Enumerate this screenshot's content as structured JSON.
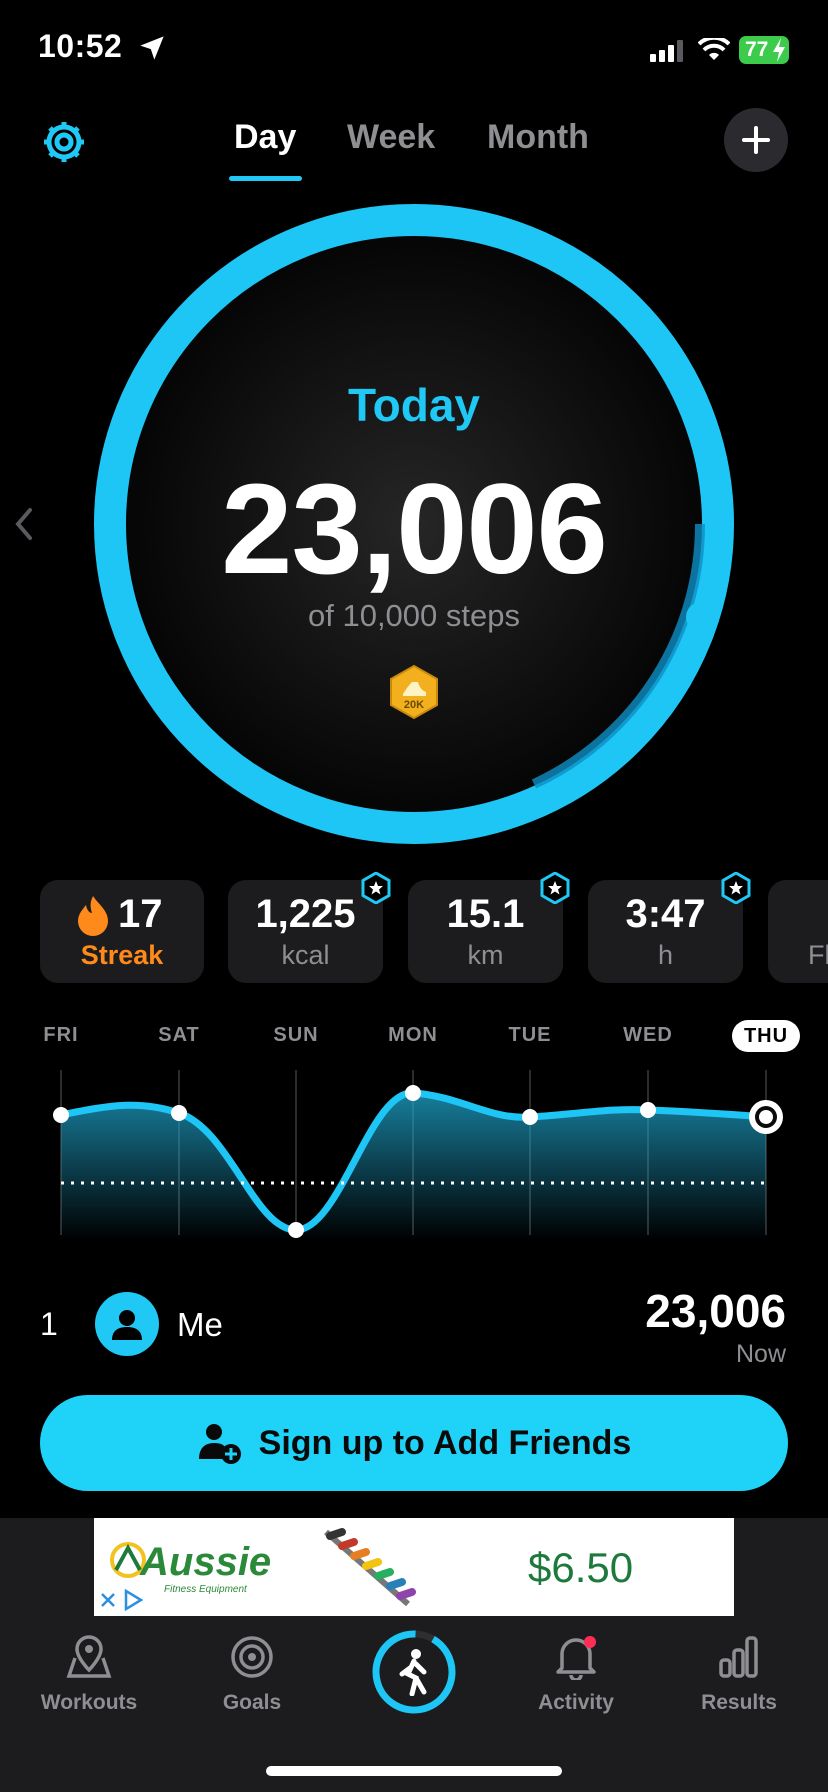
{
  "status_bar": {
    "time": "10:52",
    "battery": "77"
  },
  "header": {
    "tabs": [
      {
        "label": "Day",
        "active": true
      },
      {
        "label": "Week",
        "active": false
      },
      {
        "label": "Month",
        "active": false
      }
    ]
  },
  "ring": {
    "title": "Today",
    "steps": "23,006",
    "goal_text": "of 10,000 steps",
    "badge": "20K",
    "progress_fraction": 2.3
  },
  "stats": {
    "streak": {
      "value": "17",
      "label": "Streak"
    },
    "kcal": {
      "value": "1,225",
      "label": "kcal"
    },
    "km": {
      "value": "15.1",
      "label": "km"
    },
    "hours": {
      "value": "3:47",
      "label": "h"
    },
    "partial_label": "Fl"
  },
  "week_chart": {
    "days": [
      "FRI",
      "SAT",
      "SUN",
      "MON",
      "TUE",
      "WED",
      "THU"
    ],
    "current_day": "THU"
  },
  "leaderboard": {
    "rank": "1",
    "name": "Me",
    "steps": "23,006",
    "time": "Now"
  },
  "signup_button": "Sign up to Add Friends",
  "ad": {
    "brand": "Aussie",
    "tagline": "Fitness Equipment",
    "price": "$6.50"
  },
  "tabbar": {
    "items": [
      {
        "label": "Workouts",
        "icon": "map-pin-icon"
      },
      {
        "label": "Goals",
        "icon": "target-icon"
      },
      {
        "label": "",
        "icon": "walking-icon"
      },
      {
        "label": "Activity",
        "icon": "bell-icon"
      },
      {
        "label": "Results",
        "icon": "bar-chart-icon"
      }
    ]
  },
  "colors": {
    "accent": "#1fc8f5",
    "streak": "#ff8a1c",
    "background": "#000000",
    "card": "#1c1c1e"
  }
}
